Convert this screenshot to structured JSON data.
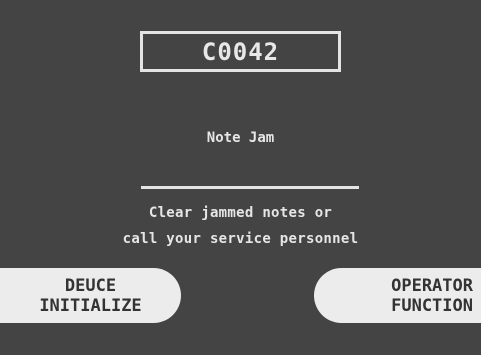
{
  "error": {
    "code": "C0042",
    "title": "Note Jam",
    "message_line1": "Clear jammed notes or",
    "message_line2": "call your service personnel"
  },
  "buttons": {
    "left": {
      "line1": "DEUCE",
      "line2": "INITIALIZE"
    },
    "right": {
      "line1": "OPERATOR",
      "line2": "FUNCTION"
    }
  },
  "colors": {
    "screen_background": "#444444",
    "text": "#e6e6e6",
    "button_background": "#ececec",
    "button_text": "#333333"
  }
}
